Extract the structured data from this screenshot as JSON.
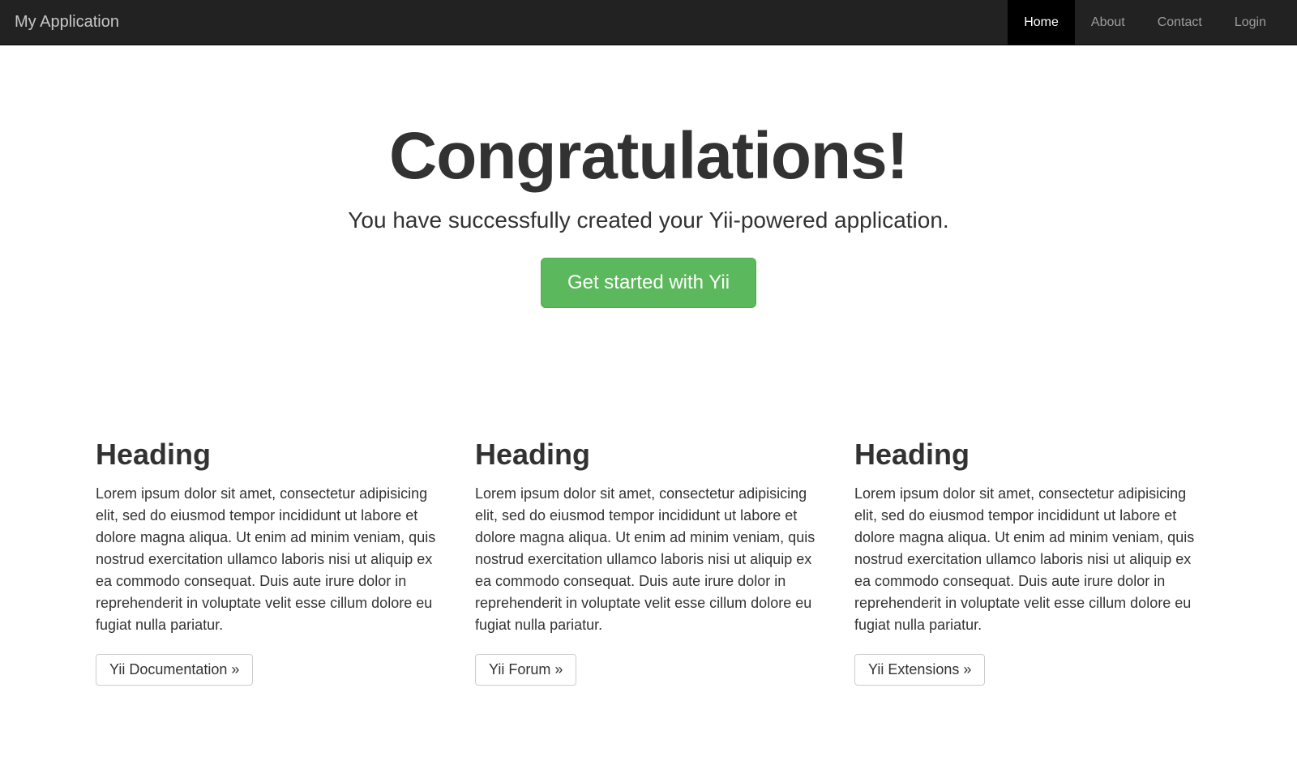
{
  "navbar": {
    "brand": "My Application",
    "items": [
      {
        "label": "Home",
        "active": true
      },
      {
        "label": "About",
        "active": false
      },
      {
        "label": "Contact",
        "active": false
      },
      {
        "label": "Login",
        "active": false
      }
    ]
  },
  "jumbotron": {
    "title": "Congratulations!",
    "lead": "You have successfully created your Yii-powered application.",
    "cta": "Get started with Yii"
  },
  "columns": [
    {
      "heading": "Heading",
      "body": "Lorem ipsum dolor sit amet, consectetur adipisicing elit, sed do eiusmod tempor incididunt ut labore et dolore magna aliqua. Ut enim ad minim veniam, quis nostrud exercitation ullamco laboris nisi ut aliquip ex ea commodo consequat. Duis aute irure dolor in reprehenderit in voluptate velit esse cillum dolore eu fugiat nulla pariatur.",
      "button": "Yii Documentation »"
    },
    {
      "heading": "Heading",
      "body": "Lorem ipsum dolor sit amet, consectetur adipisicing elit, sed do eiusmod tempor incididunt ut labore et dolore magna aliqua. Ut enim ad minim veniam, quis nostrud exercitation ullamco laboris nisi ut aliquip ex ea commodo consequat. Duis aute irure dolor in reprehenderit in voluptate velit esse cillum dolore eu fugiat nulla pariatur.",
      "button": "Yii Forum »"
    },
    {
      "heading": "Heading",
      "body": "Lorem ipsum dolor sit amet, consectetur adipisicing elit, sed do eiusmod tempor incididunt ut labore et dolore magna aliqua. Ut enim ad minim veniam, quis nostrud exercitation ullamco laboris nisi ut aliquip ex ea commodo consequat. Duis aute irure dolor in reprehenderit in voluptate velit esse cillum dolore eu fugiat nulla pariatur.",
      "button": "Yii Extensions »"
    }
  ]
}
